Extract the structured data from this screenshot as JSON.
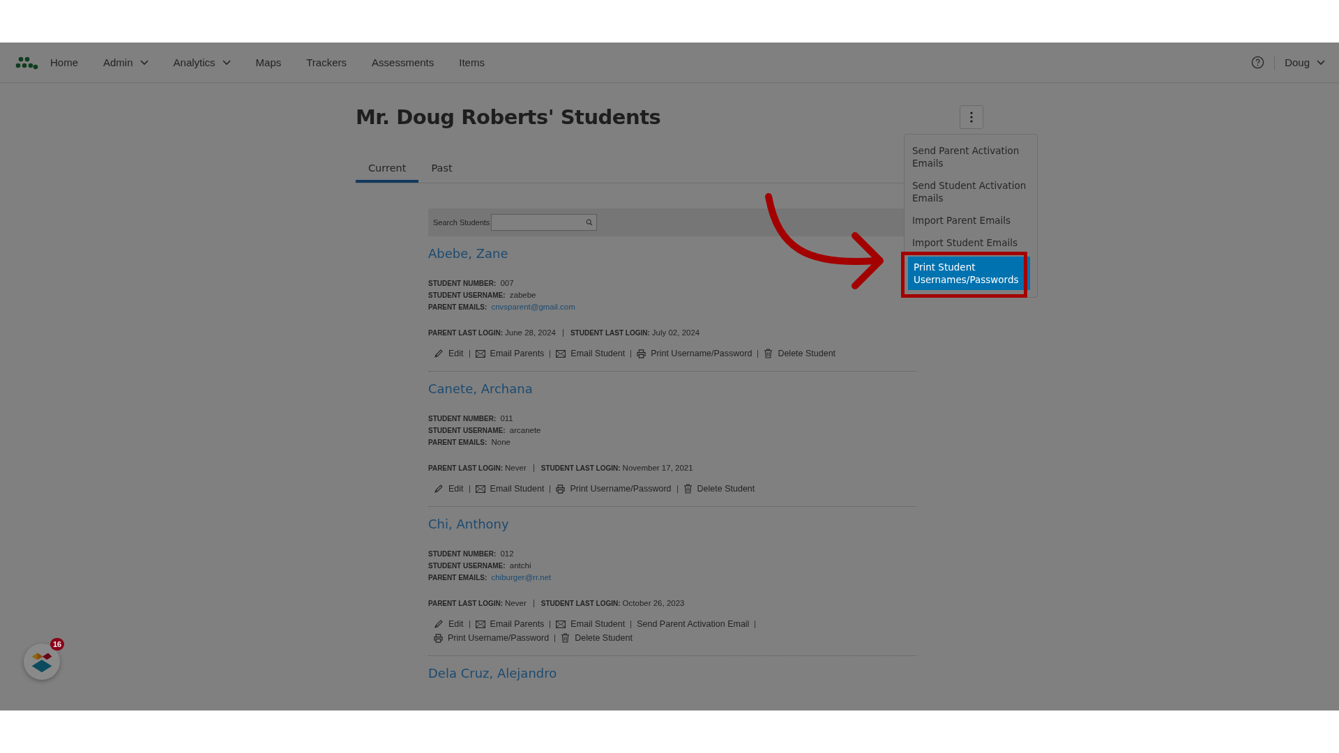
{
  "nav": {
    "items": [
      {
        "label": "Home",
        "dropdown": false
      },
      {
        "label": "Admin",
        "dropdown": true
      },
      {
        "label": "Analytics",
        "dropdown": true
      },
      {
        "label": "Maps",
        "dropdown": false
      },
      {
        "label": "Trackers",
        "dropdown": false
      },
      {
        "label": "Assessments",
        "dropdown": false
      },
      {
        "label": "Items",
        "dropdown": false
      }
    ],
    "user": "Doug"
  },
  "title": "Mr. Doug Roberts' Students",
  "tabs": [
    {
      "label": "Current",
      "selected": true
    },
    {
      "label": "Past",
      "selected": false
    }
  ],
  "search": {
    "label": "Search Students"
  },
  "menu": {
    "items": [
      {
        "label": "Send Parent Activation Emails",
        "selected": false
      },
      {
        "label": "Send Student Activation Emails",
        "selected": false
      },
      {
        "label": "Import Parent Emails",
        "selected": false
      },
      {
        "label": "Import Student Emails",
        "selected": false
      },
      {
        "label": "Print Student Usernames/Passwords",
        "selected": true
      }
    ]
  },
  "students": [
    {
      "name": "Abebe, Zane",
      "fields": [
        {
          "label": "STUDENT NUMBER:",
          "value": "007",
          "link": false
        },
        {
          "label": "STUDENT USERNAME:",
          "value": "zabebe",
          "link": false
        },
        {
          "label": "PARENT EMAILS:",
          "value": "cnvsparent@gmail.com",
          "link": true
        }
      ],
      "logins": [
        {
          "label": "PARENT LAST LOGIN:",
          "value": "June 28, 2024"
        },
        {
          "label": "STUDENT LAST LOGIN:",
          "value": "July 02, 2024"
        }
      ],
      "actions": [
        {
          "kind": "edit",
          "label": "Edit"
        },
        {
          "kind": "email",
          "label": "Email Parents"
        },
        {
          "kind": "email",
          "label": "Email Student"
        },
        {
          "kind": "print",
          "label": "Print Username/Password"
        },
        {
          "kind": "delete",
          "label": "Delete Student"
        }
      ]
    },
    {
      "name": "Canete, Archana",
      "fields": [
        {
          "label": "STUDENT NUMBER:",
          "value": "011",
          "link": false
        },
        {
          "label": "STUDENT USERNAME:",
          "value": "arcanete",
          "link": false
        },
        {
          "label": "PARENT EMAILS:",
          "value": "None",
          "link": false
        }
      ],
      "logins": [
        {
          "label": "PARENT LAST LOGIN:",
          "value": "Never"
        },
        {
          "label": "STUDENT LAST LOGIN:",
          "value": "November 17, 2021"
        }
      ],
      "actions": [
        {
          "kind": "edit",
          "label": "Edit"
        },
        {
          "kind": "email",
          "label": "Email Student"
        },
        {
          "kind": "print",
          "label": "Print Username/Password"
        },
        {
          "kind": "delete",
          "label": "Delete Student"
        }
      ]
    },
    {
      "name": "Chi, Anthony",
      "fields": [
        {
          "label": "STUDENT NUMBER:",
          "value": "012",
          "link": false
        },
        {
          "label": "STUDENT USERNAME:",
          "value": "antchi",
          "link": false
        },
        {
          "label": "PARENT EMAILS:",
          "value": "chiburger@rr.net",
          "link": true
        }
      ],
      "logins": [
        {
          "label": "PARENT LAST LOGIN:",
          "value": "Never"
        },
        {
          "label": "STUDENT LAST LOGIN:",
          "value": "October 26, 2023"
        }
      ],
      "actions": [
        {
          "kind": "edit",
          "label": "Edit"
        },
        {
          "kind": "email",
          "label": "Email Parents"
        },
        {
          "kind": "email",
          "label": "Email Student"
        },
        {
          "kind": "text",
          "label": "Send Parent Activation Email"
        },
        {
          "kind": "print",
          "label": "Print Username/Password"
        },
        {
          "kind": "delete",
          "label": "Delete Student"
        }
      ]
    },
    {
      "name": "Dela Cruz, Alejandro"
    }
  ],
  "badge": {
    "count": "16"
  }
}
